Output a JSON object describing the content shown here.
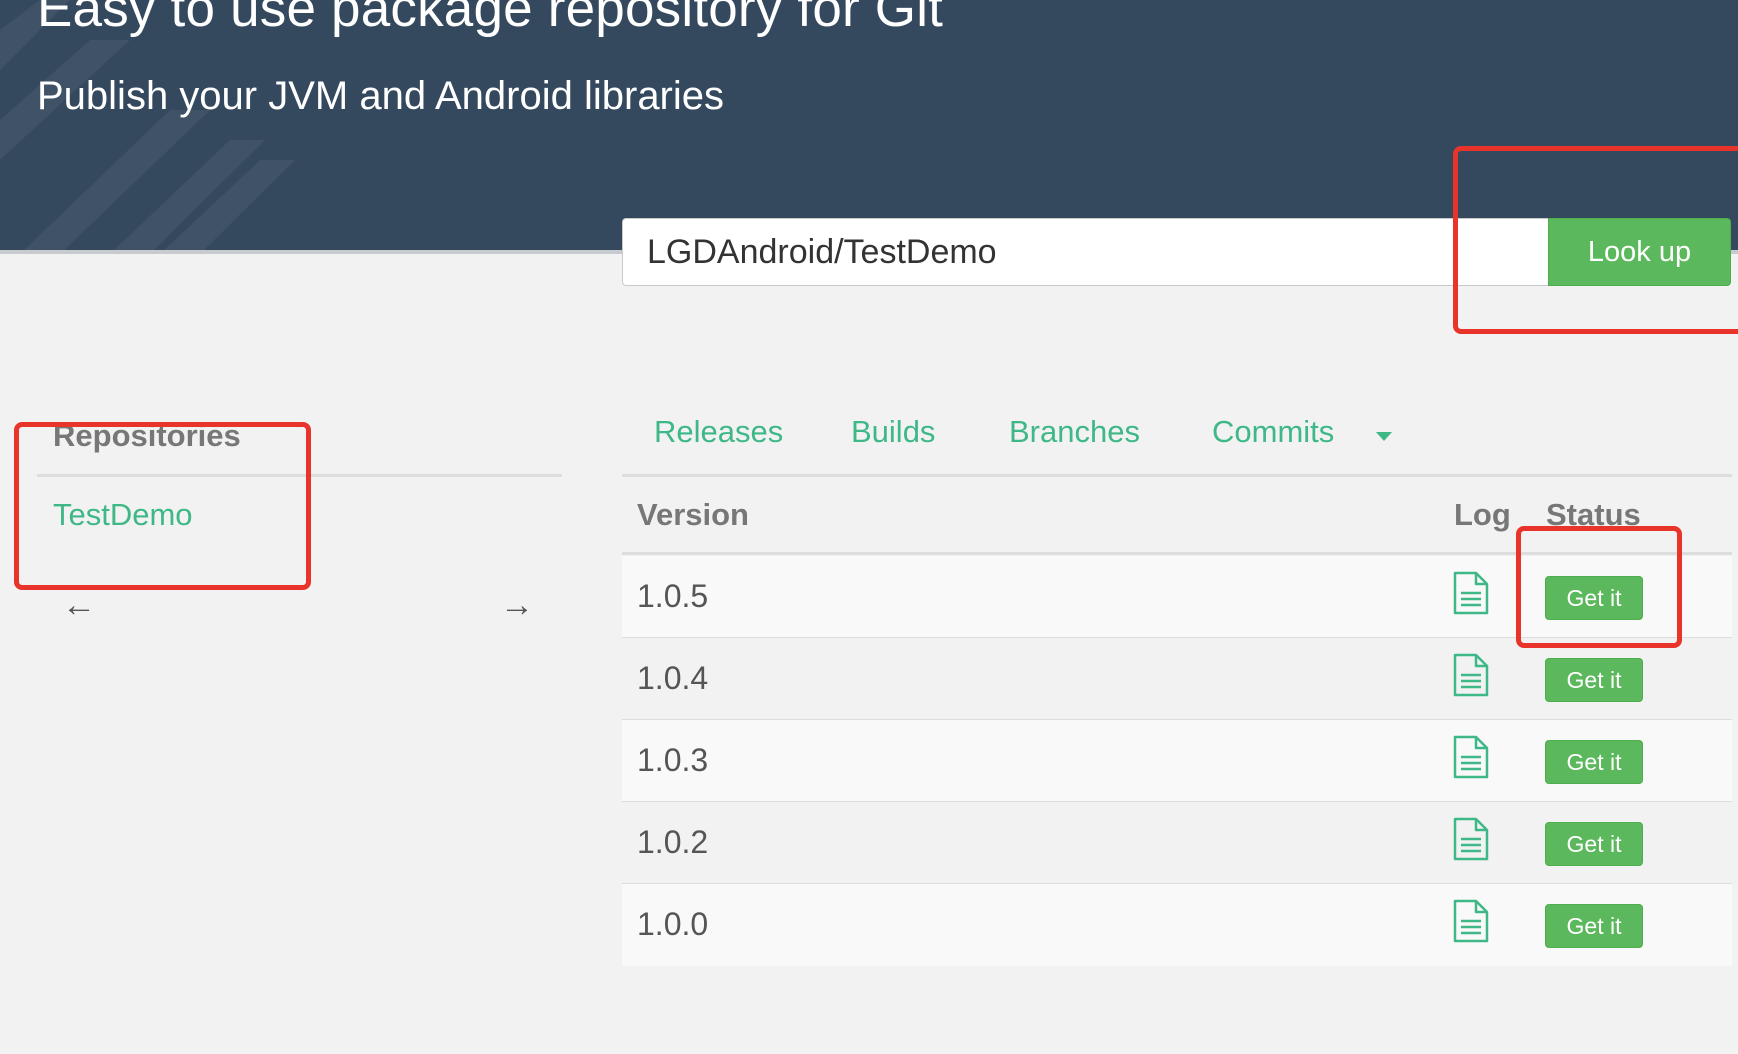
{
  "hero": {
    "title": "Easy to use package repository for Git",
    "subtitle": "Publish your JVM and Android libraries"
  },
  "search": {
    "value": "LGDAndroid/TestDemo",
    "button_label": "Look up"
  },
  "sidebar": {
    "heading": "Repositories",
    "repositories": [
      "TestDemo"
    ],
    "prev_arrow": "←",
    "next_arrow": "→"
  },
  "tabs": [
    {
      "label": "Releases"
    },
    {
      "label": "Builds"
    },
    {
      "label": "Branches"
    },
    {
      "label": "Commits"
    }
  ],
  "table": {
    "headers": {
      "version": "Version",
      "log": "Log",
      "status": "Status"
    },
    "rows": [
      {
        "version": "1.0.5",
        "action": "Get it"
      },
      {
        "version": "1.0.4",
        "action": "Get it"
      },
      {
        "version": "1.0.3",
        "action": "Get it"
      },
      {
        "version": "1.0.2",
        "action": "Get it"
      },
      {
        "version": "1.0.0",
        "action": "Get it"
      }
    ]
  },
  "colors": {
    "hero_bg": "#35495e",
    "accent_green": "#3fb888",
    "button_green": "#5cb85c",
    "annotation_red": "#e8342a"
  },
  "icons": {
    "log": "file-text-icon",
    "dropdown": "caret-down-icon"
  }
}
